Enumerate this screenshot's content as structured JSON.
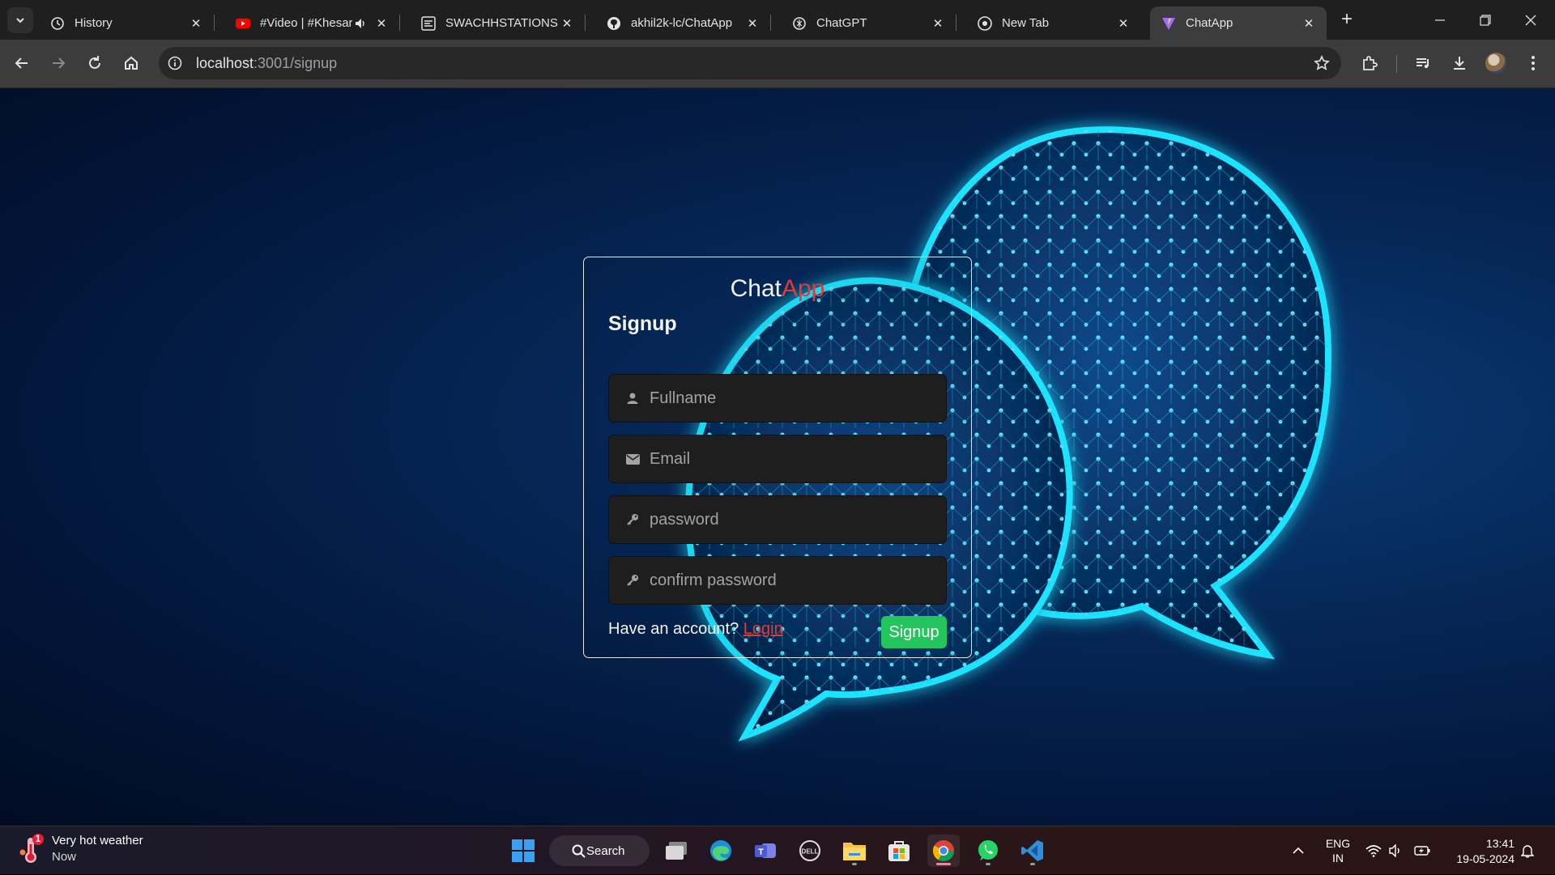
{
  "browser": {
    "tabs": [
      {
        "title": "History",
        "icon": "history-icon",
        "active": false
      },
      {
        "title": "#Video | #Khesari",
        "icon": "youtube-icon",
        "active": false,
        "audio": true
      },
      {
        "title": "SWACHHSTATIONS",
        "icon": "site-icon",
        "active": false
      },
      {
        "title": "akhil2k-lc/ChatApp",
        "icon": "github-icon",
        "active": false
      },
      {
        "title": "ChatGPT",
        "icon": "chatgpt-icon",
        "active": false
      },
      {
        "title": "New Tab",
        "icon": "chrome-icon",
        "active": false
      },
      {
        "title": "ChatApp",
        "icon": "vite-icon",
        "active": true
      }
    ],
    "address": {
      "host": "localhost",
      "path": ":3001/signup"
    }
  },
  "page": {
    "brand": {
      "main": "Chat",
      "accent": "App"
    },
    "heading": "Signup",
    "fields": [
      {
        "placeholder": "Fullname",
        "icon": "user-icon",
        "type": "text"
      },
      {
        "placeholder": "Email",
        "icon": "envelope-icon",
        "type": "email"
      },
      {
        "placeholder": "password",
        "icon": "key-icon",
        "type": "password"
      },
      {
        "placeholder": "confirm password",
        "icon": "key-icon",
        "type": "password"
      }
    ],
    "have_account": "Have an account?",
    "login_link": "Login",
    "signup_button": "Signup"
  },
  "taskbar": {
    "weather": {
      "title": "Very hot weather",
      "subtitle": "Now",
      "badge": "1"
    },
    "search_label": "Search",
    "lang": {
      "line1": "ENG",
      "line2": "IN"
    },
    "clock": {
      "time": "13:41",
      "date": "19-05-2024"
    }
  },
  "colors": {
    "accent": "#e53935",
    "signup": "#22c55e",
    "glow": "#1ee3ff"
  }
}
